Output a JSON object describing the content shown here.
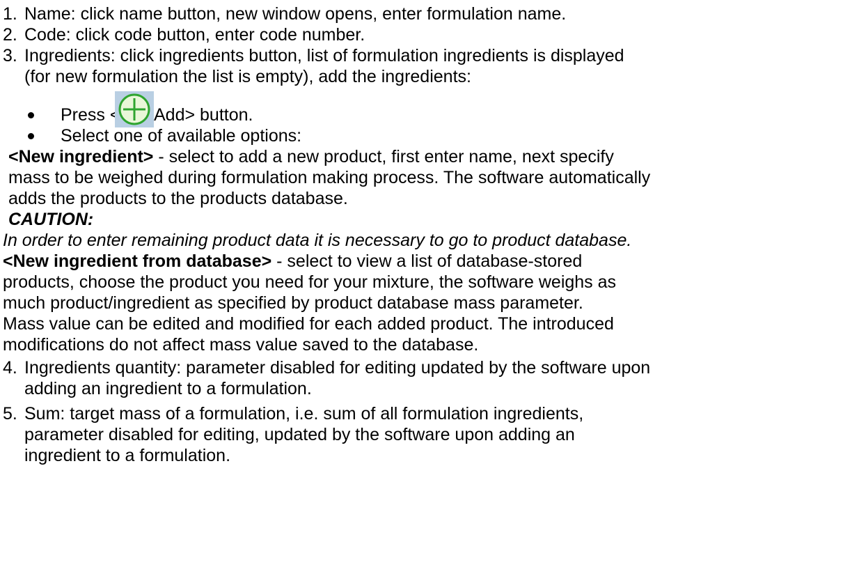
{
  "items": [
    {
      "number": "1.",
      "lines": [
        "Name: click name button, new window opens, enter formulation name."
      ]
    },
    {
      "number": "2.",
      "lines": [
        "Code: click code button, enter code number."
      ]
    },
    {
      "number": "3.",
      "lines": [
        "Ingredients: click ingredients button, list of formulation ingredients is displayed",
        "(for new formulation the list is empty), add the ingredients:"
      ]
    }
  ],
  "bullets": {
    "press_prefix": "Press <",
    "press_suffix": "Add> button.",
    "select": "Select one of available options:"
  },
  "add_icon": "add-circle-icon",
  "options": {
    "new_ingredient": {
      "label": "<New ingredient>",
      "text_1": " - select to add a new product, first enter name, next specify",
      "text_2": "mass to be weighed during formulation making process. The software automatically",
      "text_3": "adds the products to the products database."
    },
    "caution": {
      "label": "CAUTION:",
      "text": "In order to enter remaining product data it is necessary to go to product database."
    },
    "from_database": {
      "label": "<New ingredient from database>",
      "text_1": " - select to view a list of database-stored",
      "text_2": "products, choose the product you need for your mixture, the software weighs as",
      "text_3": "much product/ingredient as specified by product database mass parameter.",
      "text_4": "Mass value can be edited and modified for each added product. The introduced",
      "text_5": "modifications do not affect mass value saved to the database."
    }
  },
  "items_continued": [
    {
      "number": "4.",
      "lines": [
        "Ingredients quantity: parameter disabled for editing updated by the software upon",
        "adding an ingredient to a formulation."
      ]
    },
    {
      "number": "5.",
      "lines": [
        "Sum: target mass of a formulation, i.e. sum of all formulation ingredients,",
        "parameter disabled for editing, updated by the software upon adding an",
        "ingredient to a formulation."
      ]
    }
  ],
  "colors": {
    "icon_background": "#b9cfe3",
    "icon_ring": "#2fa52f",
    "icon_fill": "#e9f7d8"
  }
}
